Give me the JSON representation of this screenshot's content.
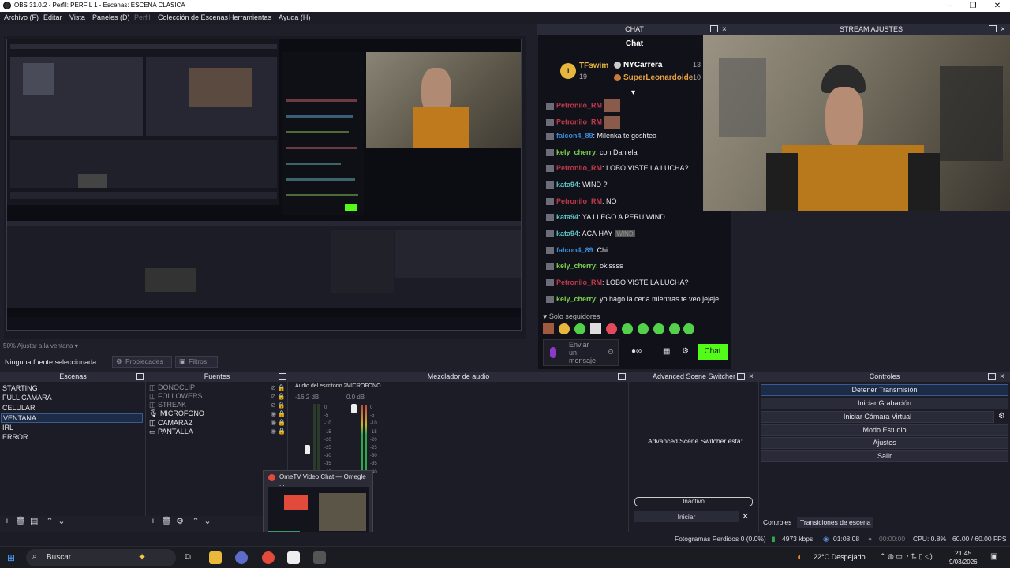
{
  "window": {
    "title": "OBS 31.0.2 - Perfil: PERFIL 1 - Escenas: ESCENA CLASICA"
  },
  "menu": [
    "Archivo (F)",
    "Editar",
    "Vista",
    "Paneles (D)",
    "Perfil",
    "Colección de Escenas",
    "Herramientas",
    "Ayuda (H)"
  ],
  "preview": {
    "zoom_label": "50% Ajustar a la ventana"
  },
  "source_bar": {
    "no_source": "Ninguna fuente seleccionada",
    "properties": "Propiedades",
    "filters": "Filtros"
  },
  "docks": {
    "chat": "CHAT",
    "stream": "STREAM AJUSTES",
    "scenes": "Escenas",
    "sources": "Fuentes",
    "mixer": "Mezclador de audio",
    "switcher": "Advanced Scene Switcher",
    "controls": "Controles"
  },
  "scenes": [
    "STARTING",
    "FULL CAMARA",
    "CELULAR",
    "VENTANA",
    "IRL",
    "ERROR"
  ],
  "selected_scene": "VENTANA",
  "sources": [
    "DONOCLIP",
    "FOLLOWERS",
    "STREAK",
    "MICROFONO",
    "CAMARA2",
    "PANTALLA"
  ],
  "mixer": {
    "ch1_name": "Audio del escritorio 2",
    "ch1_db": "-16.2 dB",
    "ch2_name": "MICROFONO",
    "ch2_db": "0.0 dB",
    "ticks": [
      "0",
      "-5",
      "-10",
      "-15",
      "-20",
      "-25",
      "-30",
      "-35",
      "-40"
    ]
  },
  "switcher": {
    "status_text": "Advanced Scene Switcher está:",
    "inactive": "Inactivo",
    "start": "Iniciar"
  },
  "controls": {
    "buttons": [
      "Detener Transmisión",
      "Iniciar Grabación",
      "Iniciar Cámara Virtual",
      "Modo Estudio",
      "Ajustes",
      "Salir"
    ],
    "tab1": "Controles",
    "tab2": "Transiciones de escena"
  },
  "chat": {
    "heading": "Chat",
    "leader1_name": "TFswim",
    "leader1_count": "19",
    "leader2_name": "NYCarrera",
    "leader2_count": "13",
    "leader3_name": "SuperLeonardoide",
    "leader3_count": "10",
    "messages": [
      {
        "user": "Petronilo_RM",
        "text": "",
        "color": "#c0394b"
      },
      {
        "user": "Petronilo_RM",
        "text": "",
        "color": "#c0394b"
      },
      {
        "user": "falcon4_89",
        "text": ": Milenka te goshtea",
        "color": "#3a8bd8"
      },
      {
        "user": "kely_cherry",
        "text": ": con Daniela",
        "color": "#7bd14b"
      },
      {
        "user": "Petronilo_RM",
        "text": ": LOBO VISTE LA LUCHA?",
        "color": "#c0394b"
      },
      {
        "user": "kata94",
        "text": ": WIND ?",
        "color": "#5ec8c8"
      },
      {
        "user": "Petronilo_RM",
        "text": ": NO",
        "color": "#c0394b"
      },
      {
        "user": "kata94",
        "text": ": YA LLEGO A PERU WIND !",
        "color": "#5ec8c8"
      },
      {
        "user": "kata94",
        "text": ": ACÁ HAY",
        "color": "#5ec8c8"
      },
      {
        "user": "falcon4_89",
        "text": ": Chi",
        "color": "#3a8bd8"
      },
      {
        "user": "kely_cherry",
        "text": ": okissss",
        "color": "#7bd14b"
      },
      {
        "user": "Petronilo_RM",
        "text": ": LOBO VISTE LA LUCHA?",
        "color": "#c0394b"
      },
      {
        "user": "kely_cherry",
        "text": ": yo hago la cena mientras te veo jejeje",
        "color": "#7bd14b"
      }
    ],
    "followers_only": "Solo seguidores",
    "input_placeholder": "Enviar un mensaje",
    "send": "Chat",
    "emote_word": "WIND"
  },
  "popup": {
    "title": "OmeTV Video Chat — Omegle ..."
  },
  "status": {
    "dropped": "Fotogramas Perdidos 0 (0.0%)",
    "kbps": "4973 kbps",
    "stream_time": "01:08:08",
    "rec_time": "00:00:00",
    "cpu": "CPU: 0.8%",
    "fps": "60.00 / 60.00 FPS"
  },
  "taskbar": {
    "search": "Buscar",
    "weather": "22°C  Despejado",
    "time": "21:45",
    "date": "9/03/2026"
  },
  "colors": {
    "accent": "#53fc18",
    "selected": "#1c2c46",
    "bg": "#1e1f29"
  }
}
